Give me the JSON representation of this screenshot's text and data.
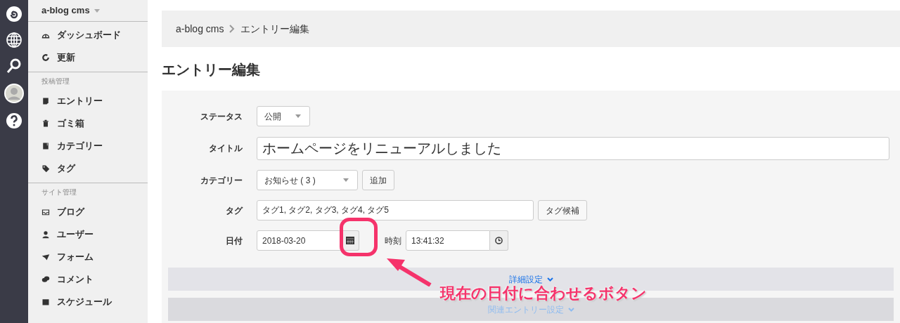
{
  "sidebar": {
    "site_name": "a-blog cms",
    "sections": [
      {
        "items": [
          {
            "label": "ダッシュボード"
          },
          {
            "label": "更新"
          }
        ]
      },
      {
        "heading": "投稿管理",
        "items": [
          {
            "label": "エントリー"
          },
          {
            "label": "ゴミ箱"
          },
          {
            "label": "カテゴリー"
          },
          {
            "label": "タグ"
          }
        ]
      },
      {
        "heading": "サイト管理",
        "items": [
          {
            "label": "ブログ"
          },
          {
            "label": "ユーザー"
          },
          {
            "label": "フォーム"
          },
          {
            "label": "コメント"
          },
          {
            "label": "スケジュール"
          }
        ]
      }
    ]
  },
  "breadcrumb": [
    "a-blog cms",
    "エントリー編集"
  ],
  "page_title": "エントリー編集",
  "form": {
    "rows": [
      {
        "kind": "select",
        "label": "ステータス",
        "value": "公開"
      },
      {
        "kind": "title",
        "label": "タイトル",
        "value": "ホームページをリニューアルしました"
      },
      {
        "kind": "select_button",
        "label": "カテゴリー",
        "value": "お知らせ ( 3 )",
        "button": "追加"
      },
      {
        "kind": "text_button",
        "label": "タグ",
        "value": "タグ1, タグ2, タグ3, タグ4, タグ5",
        "button": "タグ候補"
      },
      {
        "kind": "datetime",
        "label": "日付",
        "value": "2018-03-20",
        "time_label": "時刻",
        "time_value": "13:41:32"
      }
    ]
  },
  "sections": [
    {
      "label": "詳細設定",
      "disabled": false
    },
    {
      "label": "関連エントリー設定",
      "disabled": true
    }
  ],
  "annotation": {
    "text": "現在の日付に合わせるボタン"
  }
}
